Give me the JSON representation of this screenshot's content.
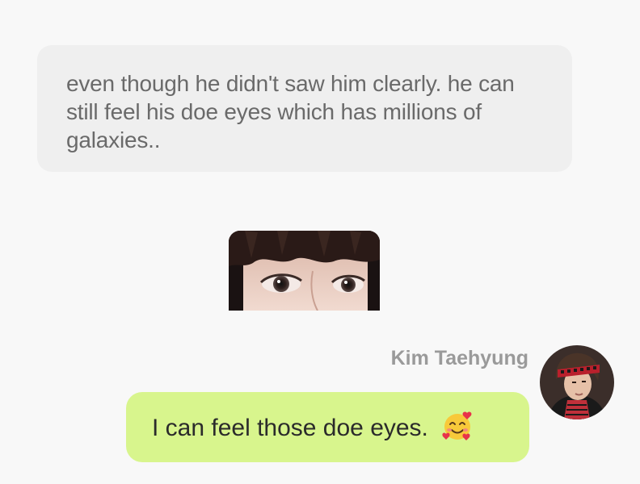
{
  "narration": {
    "text": "even though he didn't saw him clearly.  he can still feel his doe eyes which has millions of galaxies.."
  },
  "photo": {
    "icon": "eyes-photo"
  },
  "message": {
    "sender": "Kim Taehyung",
    "text": "I can feel those doe eyes.",
    "emoji": "smiling-face-with-hearts",
    "bubble_color": "#d8f58d"
  },
  "avatar": {
    "icon": "profile-photo"
  }
}
